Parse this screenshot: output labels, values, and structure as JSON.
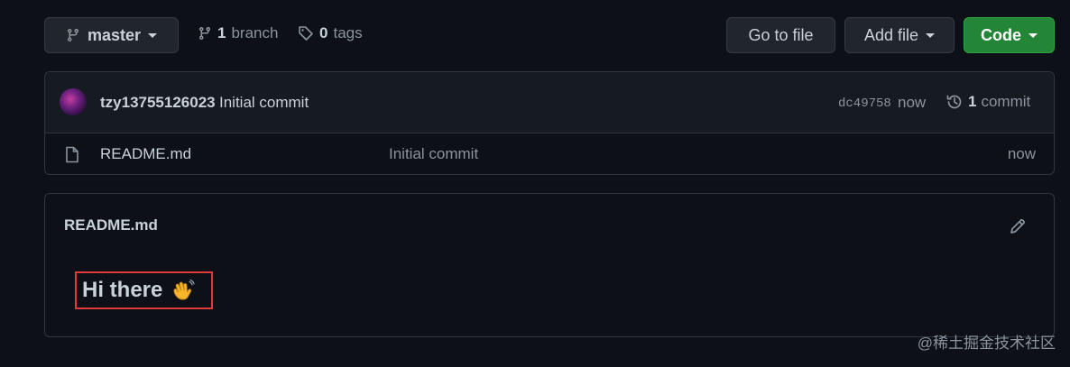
{
  "toolbar": {
    "branch_selector": "master",
    "branch_count": "1",
    "branch_label": "branch",
    "tag_count": "0",
    "tag_label": "tags",
    "go_to_file": "Go to file",
    "add_file": "Add file",
    "code": "Code"
  },
  "commit": {
    "author": "tzy13755126023",
    "message": "Initial commit",
    "sha": "dc49758",
    "time": "now",
    "count": "1",
    "count_label": "commit"
  },
  "files": [
    {
      "icon": "file-icon",
      "name": "README.md",
      "last_commit": "Initial commit",
      "time": "now"
    }
  ],
  "readme": {
    "title": "README.md",
    "heading": "Hi there",
    "emoji": "👋"
  },
  "watermark": "@稀土掘金技术社区",
  "colors": {
    "background": "#0d1117",
    "primary_button": "#238636",
    "highlight_border": "#e03c3c"
  }
}
